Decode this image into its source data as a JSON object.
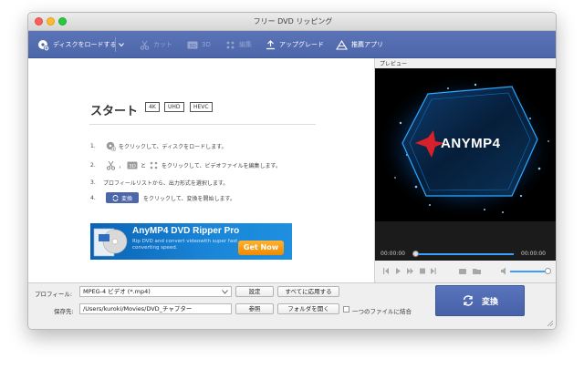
{
  "window": {
    "title": "フリー DVD リッピング"
  },
  "toolbar": {
    "load_disc": "ディスクをロードする",
    "cut": "カット",
    "threed": "3D",
    "edit": "編集",
    "upgrade": "アップグレード",
    "recommended": "推薦アプリ"
  },
  "start": {
    "title": "スタート",
    "formats": [
      "4K",
      "UHD",
      "HEVC"
    ],
    "steps": [
      {
        "num": "1.",
        "text": "をクリックして、ディスクをロードします。"
      },
      {
        "num": "2.",
        "text_sep1": "，",
        "text_sep2": "と",
        "text": "をクリックして、ビデオファイルを編集します。"
      },
      {
        "num": "3.",
        "text": "プロフィールリストから、出力形式を選択します。"
      },
      {
        "num": "4.",
        "button": "変換",
        "text": "をクリックして、変換を開始します。"
      }
    ]
  },
  "banner": {
    "title": "AnyMP4 DVD Ripper Pro",
    "subtitle": "Rip DVD and convert videowith super fast converting speed.",
    "button": "Get Now"
  },
  "preview": {
    "label": "プレビュー",
    "brand": "ANYMP4",
    "time_current": "00:00:00",
    "time_total": "00:00:00",
    "progress": 0,
    "volume": 0.8
  },
  "bottom": {
    "profile_label": "プロフィール:",
    "profile_value": "MPEG-4 ビデオ (*.mp4)",
    "settings_button": "設定",
    "apply_all_button": "すべてに応用する",
    "dest_label": "保存先:",
    "dest_value": "/Users/kuroki/Movies/DVD_チャプター",
    "browse_button": "参照",
    "open_folder_button": "フォルダを開く",
    "merge_label": "一つのファイルに結合",
    "convert_button": "変換"
  },
  "colors": {
    "toolbar": "#4d66aa",
    "convert": "#4d66aa",
    "accent": "#3aa0ff",
    "banner_button": "#f08a00"
  }
}
